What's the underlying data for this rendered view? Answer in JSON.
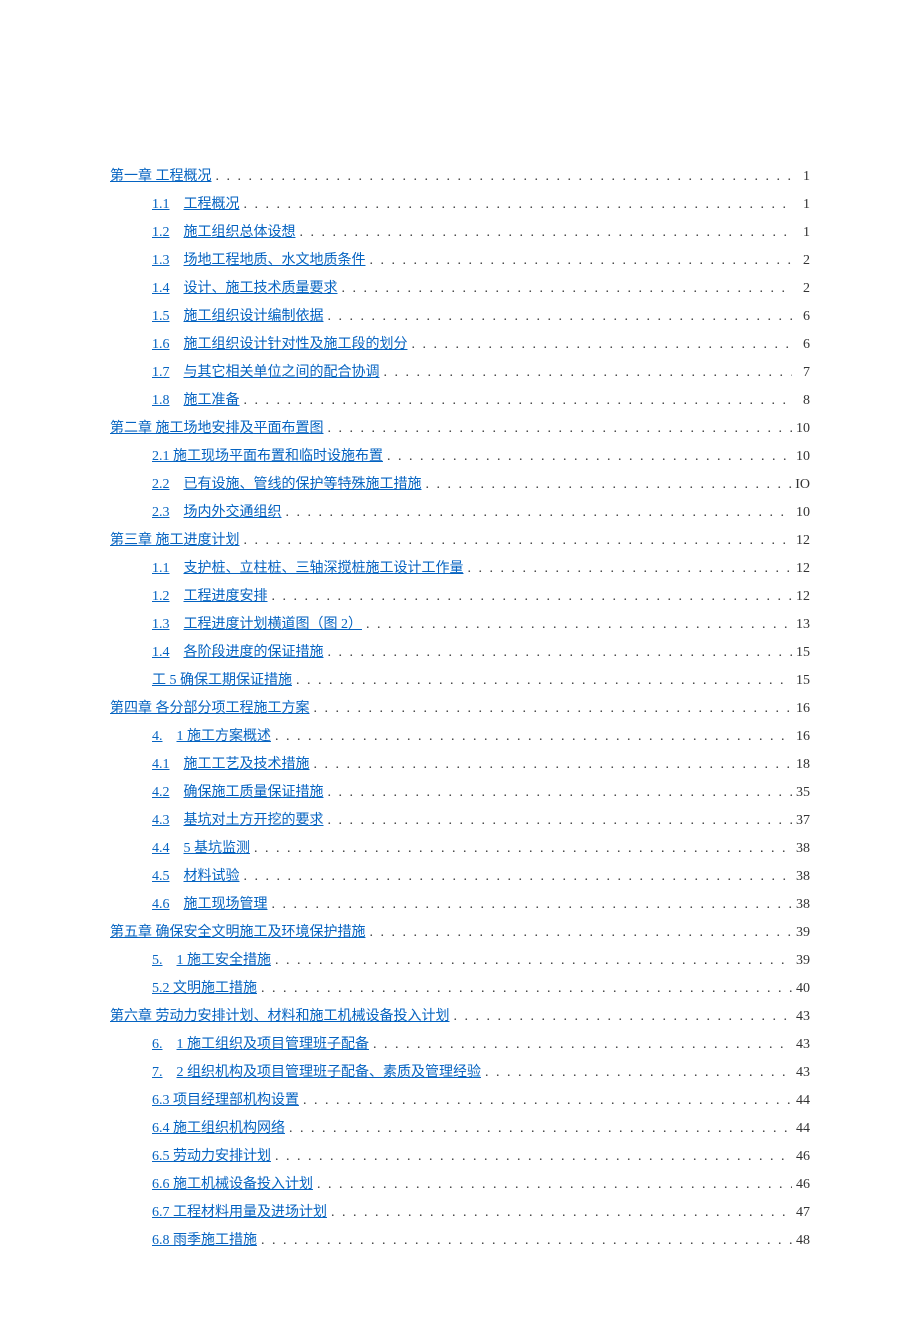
{
  "toc": [
    {
      "level": 0,
      "num": "",
      "title": "第一章 工程概况",
      "page": "1",
      "combined": true
    },
    {
      "level": 1,
      "num": "1.1",
      "title": "工程概况",
      "page": "1"
    },
    {
      "level": 1,
      "num": "1.2",
      "title": "施工组织总体设想",
      "page": "1"
    },
    {
      "level": 1,
      "num": "1.3",
      "title": "场地工程地质、水文地质条件",
      "page": "2"
    },
    {
      "level": 1,
      "num": "1.4",
      "title": "设计、施工技术质量要求",
      "page": "2"
    },
    {
      "level": 1,
      "num": "1.5",
      "title": "施工组织设计编制依据",
      "page": "6"
    },
    {
      "level": 1,
      "num": "1.6",
      "title": "施工组织设计针对性及施工段的划分",
      "page": "6"
    },
    {
      "level": 1,
      "num": "1.7",
      "title": "与其它相关单位之间的配合协调",
      "page": "7"
    },
    {
      "level": 1,
      "num": "1.8",
      "title": "施工准备",
      "page": "8"
    },
    {
      "level": 0,
      "num": "",
      "title": "第二章 施工场地安排及平面布置图",
      "page": "10",
      "combined": true
    },
    {
      "level": 1,
      "num": "",
      "title": "2.1 施工现场平面布置和临时设施布置",
      "page": "10",
      "combined": true
    },
    {
      "level": 1,
      "num": "2.2",
      "title": "已有设施、管线的保护等特殊施工措施",
      "page": "IO"
    },
    {
      "level": 1,
      "num": "2.3",
      "title": "场内外交通组织",
      "page": "10"
    },
    {
      "level": 0,
      "num": "",
      "title": "第三章 施工进度计划",
      "page": "12",
      "combined": true
    },
    {
      "level": 1,
      "num": "1.1",
      "title": "支护桩、立柱桩、三轴深搅桩施工设计工作量",
      "page": "12"
    },
    {
      "level": 1,
      "num": "1.2",
      "title": "工程进度安排",
      "page": "12"
    },
    {
      "level": 1,
      "num": "1.3",
      "title": "工程进度计划横道图（图 2）",
      "page": "13"
    },
    {
      "level": 1,
      "num": "1.4",
      "title": "各阶段进度的保证措施",
      "page": "15"
    },
    {
      "level": 1,
      "num": "",
      "title": "工 5 确保工期保证措施",
      "page": "15",
      "combined": true
    },
    {
      "level": 0,
      "num": "",
      "title": "第四章 各分部分项工程施工方案",
      "page": "16",
      "combined": true
    },
    {
      "level": 1,
      "num": "4.",
      "title": "1 施工方案概述",
      "page": "16"
    },
    {
      "level": 1,
      "num": "4.1",
      "title": "施工工艺及技术措施",
      "page": "18"
    },
    {
      "level": 1,
      "num": "4.2",
      "title": "确保施工质量保证措施",
      "page": "35"
    },
    {
      "level": 1,
      "num": "4.3",
      "title": "基坑对土方开挖的要求",
      "page": "37"
    },
    {
      "level": 1,
      "num": "4.4",
      "title": "5 基坑监测",
      "page": "38"
    },
    {
      "level": 1,
      "num": "4.5",
      "title": "材料试验",
      "page": "38"
    },
    {
      "level": 1,
      "num": "4.6",
      "title": "施工现场管理",
      "page": "38"
    },
    {
      "level": 0,
      "num": "",
      "title": "第五章 确保安全文明施工及环境保护措施",
      "page": "39",
      "combined": true
    },
    {
      "level": 1,
      "num": "5.",
      "title": "1 施工安全措施",
      "page": "39"
    },
    {
      "level": 1,
      "num": "",
      "title": "5.2 文明施工措施",
      "page": "40",
      "combined": true
    },
    {
      "level": 0,
      "num": "",
      "title": "第六章 劳动力安排计划、材料和施工机械设备投入计划",
      "page": "43",
      "combined": true
    },
    {
      "level": 1,
      "num": "6.",
      "title": "1 施工组织及项目管理班子配备",
      "page": "43"
    },
    {
      "level": 1,
      "num": "7.",
      "title": "2 组织机构及项目管理班子配备、素质及管理经验",
      "page": "43"
    },
    {
      "level": 1,
      "num": "",
      "title": "6.3 项目经理部机构设置",
      "page": "44",
      "combined": true
    },
    {
      "level": 1,
      "num": "",
      "title": "6.4 施工组织机构网络",
      "page": "44",
      "combined": true
    },
    {
      "level": 1,
      "num": "",
      "title": "6.5 劳动力安排计划",
      "page": "46",
      "combined": true
    },
    {
      "level": 1,
      "num": "",
      "title": "6.6 施工机械设备投入计划",
      "page": "46",
      "combined": true
    },
    {
      "level": 1,
      "num": "",
      "title": "6.7 工程材料用量及进场计划",
      "page": "47",
      "combined": true
    },
    {
      "level": 1,
      "num": "",
      "title": "6.8 雨季施工措施",
      "page": "48",
      "combined": true
    }
  ]
}
